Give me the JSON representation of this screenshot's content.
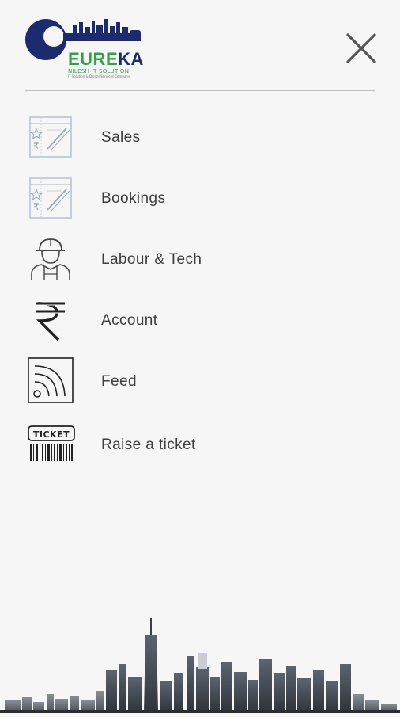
{
  "logo": {
    "wordmark_part1": "EURE",
    "wordmark_part2": "KA",
    "subtitle": "NILESH IT SOLUTION",
    "tagline": "IT Solution & Digital Services Company"
  },
  "menu": {
    "items": [
      {
        "label": "Sales",
        "icon": "sales-clipboard-icon"
      },
      {
        "label": "Bookings",
        "icon": "bookings-clipboard-icon"
      },
      {
        "label": "Labour & Tech",
        "icon": "worker-hardhat-icon"
      },
      {
        "label": "Account",
        "icon": "rupee-icon"
      },
      {
        "label": "Feed",
        "icon": "rss-feed-icon"
      },
      {
        "label": "Raise a ticket",
        "icon": "ticket-barcode-icon"
      }
    ]
  },
  "colors": {
    "background": "#f6f6f6",
    "brand_navy": "#1c2a6e",
    "brand_green": "#35a04a",
    "text": "#3d3d3d",
    "divider": "#bdbdbd"
  }
}
